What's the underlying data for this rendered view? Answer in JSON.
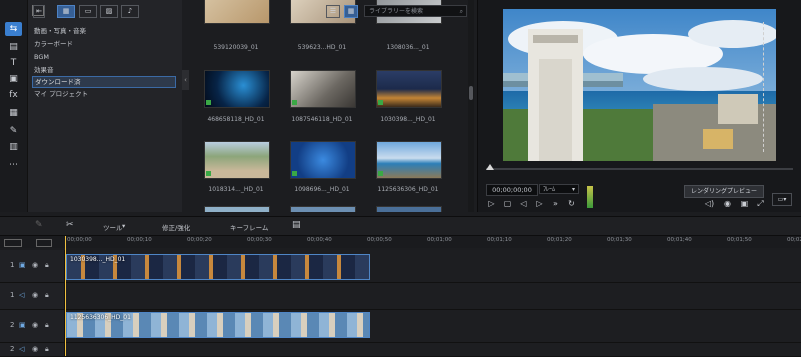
{
  "colors": {
    "accent": "#3a7fd0",
    "clip_border": "#4f86c6",
    "playhead": "#f0c040",
    "badge": "#3aa845"
  },
  "left_toolbar": {
    "items": [
      "media-icon",
      "transition-icon",
      "title-icon",
      "pip-icon",
      "effects-icon",
      "particle-icon",
      "audio-icon",
      "subtitle-icon",
      "more-icon"
    ]
  },
  "categories": [
    {
      "label": "動画・写真・音楽"
    },
    {
      "label": "カラーボード"
    },
    {
      "label": "BGM"
    },
    {
      "label": "効果音"
    },
    {
      "label": "ダウンロード済"
    },
    {
      "label": "マイ プロジェクト"
    }
  ],
  "media_toolbar": {
    "search_placeholder": "ライブラリーを検索"
  },
  "media_items": [
    {
      "label": "539120039_01"
    },
    {
      "label": "539623...HD_01"
    },
    {
      "label": "1308036..._01"
    },
    {
      "label": "468658118_HD_01"
    },
    {
      "label": "1087546118_HD_01"
    },
    {
      "label": "1030398..._HD_01"
    },
    {
      "label": "1018314..._HD_01"
    },
    {
      "label": "1098696..._HD_01"
    },
    {
      "label": "1125636306_HD_01"
    }
  ],
  "preview": {
    "timecode": "00;00;00;00",
    "unit": "ﾌﾚｰﾑ",
    "render_button": "レンダリングプレビュー"
  },
  "toolrow": {
    "tool_menu": "ツール",
    "fix_enhance": "修正/強化",
    "keyframe": "キーフレーム"
  },
  "ruler": [
    "00;00;00",
    "00;00;10",
    "00;00;20",
    "00;00;30",
    "00;00;40",
    "00;00;50",
    "00;01;00",
    "00;01;10",
    "00;01;20",
    "00;01;30",
    "00;01;40",
    "00;01;50",
    "00;02;00"
  ],
  "tracks": [
    {
      "num": "1",
      "type": "video",
      "clip_label": "1030398..._HD_01"
    },
    {
      "num": "1",
      "type": "audio",
      "clip_label": ""
    },
    {
      "num": "2",
      "type": "video",
      "clip_label": "1125636306_HD_01"
    },
    {
      "num": "2",
      "type": "audio",
      "clip_label": ""
    }
  ]
}
